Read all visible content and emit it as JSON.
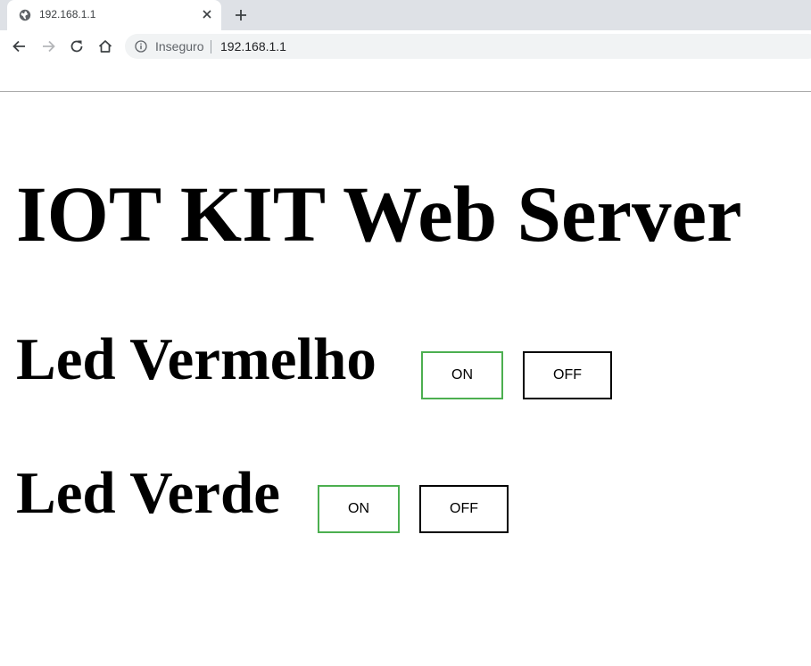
{
  "browser": {
    "tab_title": "192.168.1.1",
    "security_label": "Inseguro",
    "url": "192.168.1.1",
    "icons": {
      "favicon": "globe-icon",
      "tab_close": "close-icon",
      "new_tab": "plus-icon",
      "back": "back-arrow-icon",
      "forward": "forward-arrow-icon",
      "reload": "reload-icon",
      "home": "home-icon",
      "site_info": "info-icon"
    }
  },
  "page": {
    "title": "IOT KIT Web Server",
    "leds": [
      {
        "label": "Led Vermelho",
        "on_label": "ON",
        "off_label": "OFF"
      },
      {
        "label": "Led Verde",
        "on_label": "ON",
        "off_label": "OFF"
      }
    ],
    "colors": {
      "on_border": "#4caf50",
      "off_border": "#000000"
    }
  }
}
